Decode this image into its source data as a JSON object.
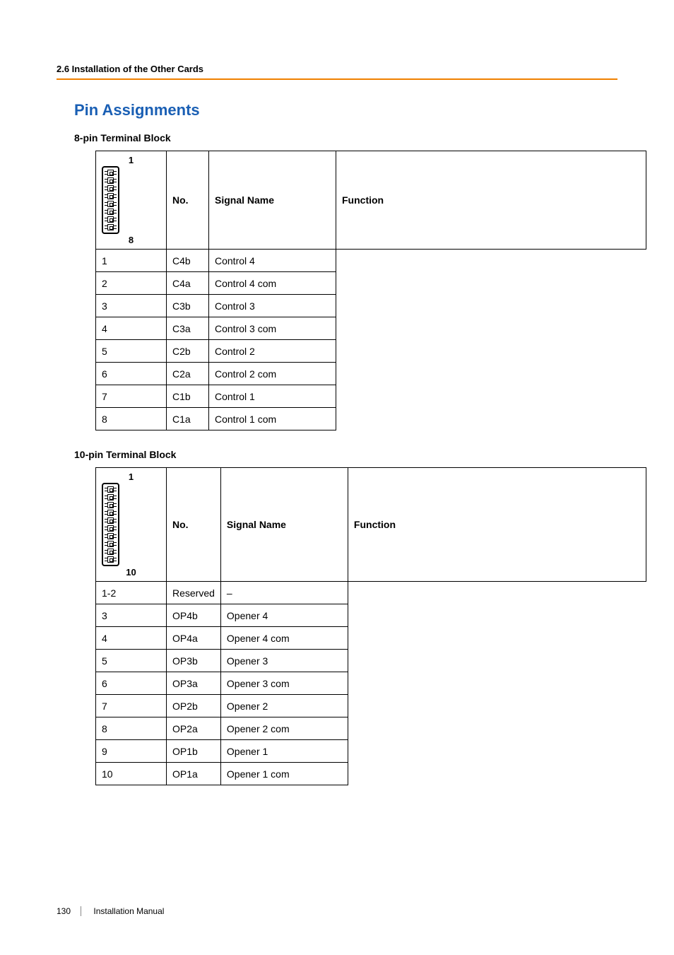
{
  "header": {
    "section": "2.6 Installation of the Other Cards"
  },
  "title": "Pin Assignments",
  "table1": {
    "caption": "8-pin Terminal Block",
    "conn": {
      "top": "1",
      "bottom": "8",
      "pins": 8
    },
    "headers": {
      "no": "No.",
      "signal": "Signal Name",
      "function": "Function"
    },
    "rows": [
      {
        "no": "1",
        "signal": "C4b",
        "function": "Control 4"
      },
      {
        "no": "2",
        "signal": "C4a",
        "function": "Control 4 com"
      },
      {
        "no": "3",
        "signal": "C3b",
        "function": "Control 3"
      },
      {
        "no": "4",
        "signal": "C3a",
        "function": "Control 3 com"
      },
      {
        "no": "5",
        "signal": "C2b",
        "function": "Control 2"
      },
      {
        "no": "6",
        "signal": "C2a",
        "function": "Control 2 com"
      },
      {
        "no": "7",
        "signal": "C1b",
        "function": "Control 1"
      },
      {
        "no": "8",
        "signal": "C1a",
        "function": "Control 1 com"
      }
    ]
  },
  "table2": {
    "caption": "10-pin Terminal Block",
    "conn": {
      "top": "1",
      "bottom": "10",
      "pins": 10
    },
    "headers": {
      "no": "No.",
      "signal": "Signal Name",
      "function": "Function"
    },
    "rows": [
      {
        "no": "1-2",
        "signal": "Reserved",
        "function": "–"
      },
      {
        "no": "3",
        "signal": "OP4b",
        "function": "Opener 4"
      },
      {
        "no": "4",
        "signal": "OP4a",
        "function": "Opener 4 com"
      },
      {
        "no": "5",
        "signal": "OP3b",
        "function": "Opener 3"
      },
      {
        "no": "6",
        "signal": "OP3a",
        "function": "Opener 3 com"
      },
      {
        "no": "7",
        "signal": "OP2b",
        "function": "Opener 2"
      },
      {
        "no": "8",
        "signal": "OP2a",
        "function": "Opener 2 com"
      },
      {
        "no": "9",
        "signal": "OP1b",
        "function": "Opener 1"
      },
      {
        "no": "10",
        "signal": "OP1a",
        "function": "Opener 1 com"
      }
    ]
  },
  "footer": {
    "page": "130",
    "doc": "Installation Manual"
  }
}
